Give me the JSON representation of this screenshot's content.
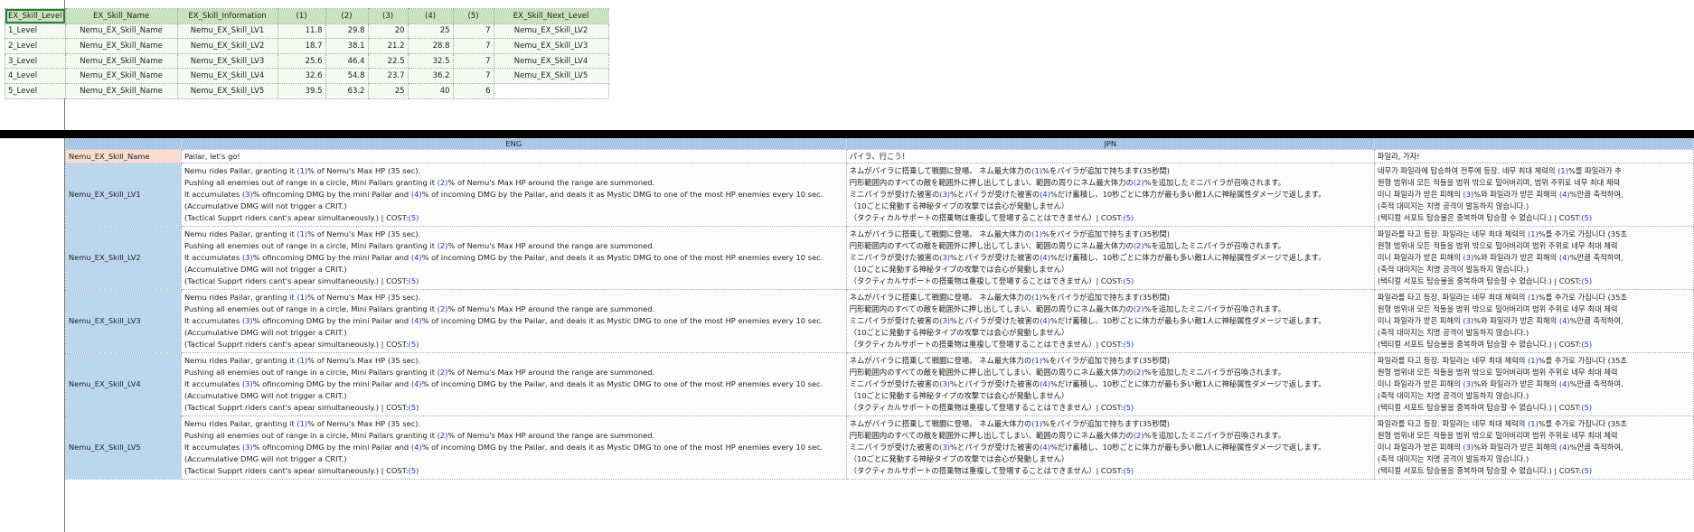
{
  "top_table": {
    "headers": [
      "EX_Skill_Level",
      "EX_Skill_Name",
      "EX_Skill_Information",
      "(1)",
      "(2)",
      "(3)",
      "(4)",
      "(5)",
      "EX_Skill_Next_Level"
    ],
    "rows": [
      [
        "1_Level",
        "Nemu_EX_Skill_Name",
        "Nemu_EX_Skill_LV1",
        "11.8",
        "29.8",
        "20",
        "25",
        "7",
        "Nemu_EX_Skill_LV2"
      ],
      [
        "2_Level",
        "Nemu_EX_Skill_Name",
        "Nemu_EX_Skill_LV2",
        "18.7",
        "38.1",
        "21.2",
        "28.8",
        "7",
        "Nemu_EX_Skill_LV3"
      ],
      [
        "3_Level",
        "Nemu_EX_Skill_Name",
        "Nemu_EX_Skill_LV3",
        "25.6",
        "46.4",
        "22.5",
        "32.5",
        "7",
        "Nemu_EX_Skill_LV4"
      ],
      [
        "4_Level",
        "Nemu_EX_Skill_Name",
        "Nemu_EX_Skill_LV4",
        "32.6",
        "54.8",
        "23.7",
        "36.2",
        "7",
        "Nemu_EX_Skill_LV5"
      ],
      [
        "5_Level",
        "Nemu_EX_Skill_Name",
        "Nemu_EX_Skill_LV5",
        "39.5",
        "63.2",
        "25",
        "40",
        "6",
        ""
      ]
    ]
  },
  "bottom_table": {
    "col_headers": [
      "",
      "ENG",
      "JPN",
      ""
    ],
    "name_row": {
      "key": "Nemu_EX_Skill_Name",
      "eng": "Pailar, let's go!",
      "jpn": "パイラ、行こう！",
      "kor": "파일라, 가자!"
    },
    "level_keys": [
      "Nemu_EX_Skill_LV1",
      "Nemu_EX_Skill_LV2",
      "Nemu_EX_Skill_LV3",
      "Nemu_EX_Skill_LV4",
      "Nemu_EX_Skill_LV5"
    ],
    "eng_lines": [
      [
        "Nemu rides Pailar, granting it ",
        "(1)",
        "% of Nemu's Max HP (35 sec)."
      ],
      [
        "Pushing all enemies out of range in a circle, Mini Pailars granting it ",
        "(2)",
        "% of Nemu's Max HP around the range are summoned."
      ],
      [
        "It accumulates ",
        "(3)",
        "% ofincoming DMG by the mini Pailar and ",
        "(4)",
        "% of incoming DMG by the Pailar, and deals it as Mystic DMG to one of the most HP enemies every 10 sec."
      ],
      [
        "(Accumulative DMG will not trigger a CRIT.)"
      ],
      [
        "(Tactical Supprt riders cant's apear simultaneously.) | COST:",
        "(5)"
      ]
    ],
    "jpn_lines": [
      [
        "ネムがパイラに搭乗して戦闘に登場。 ネム最大体力の",
        "(1)",
        "%をパイラが追加で持ちます(35秒間)"
      ],
      [
        "円形範囲内のすべての敵を範囲外に押し出してしまい、範囲の周りにネム最大体力の",
        "(2)",
        "%を追加したミニパイラが召喚されます。"
      ],
      [
        "ミニパイラが受けた被害の",
        "(3)",
        "%とパイラが受けた被害の",
        "(4)",
        "%だけ蓄積し、10秒ごとに体力が最も多い敵1人に神秘属性ダメージで返します。"
      ],
      [
        "（10ごとに発動する神秘タイプの攻撃では会心が発動しません）"
      ],
      [
        "（タクティカルサポートの搭乗物は重複して登場することはできません）| COST:",
        "(5)"
      ]
    ],
    "kor_lines_lv1": [
      [
        "네무가 파일라에 탑승하여 전투에 등장. 네무 최대 체력의 ",
        "(1)",
        "%를 파일라가 추"
      ],
      [
        "원형 범위내 모든 적들을 범위 밖으로 밀어버리며, 범위 주위로 네무 최대 체력"
      ],
      [
        "미니 파일라가 받은 피해의 ",
        "(3)",
        "%와 파일라가 받은 피해의 ",
        "(4)",
        "%만큼 축적하여,"
      ],
      [
        "(축적 대미지는 치명 공격이 발동하지 않습니다.)"
      ],
      [
        "(택티컬 서포트 탑승물은 중복하여 탑승할 수 없습니다.) | COST:",
        "(5)"
      ]
    ],
    "kor_lines": [
      [
        "파일라를 타고 등장. 파일라는 네무 최대 체력의 ",
        "(1)",
        "%를 추가로 가집니다 (35초"
      ],
      [
        "원형 범위내 모든 적들을 범위 밖으로 밀어버리며 범위 주위로 네무 최대 체력"
      ],
      [
        "미니 파일라가 받은 피해의 ",
        "(3)",
        "%와 파일라가 받은 피해의 ",
        "(4)",
        "%만큼 축적하여,"
      ],
      [
        "(축적 대미지는 치명 공격이 발동하지 않습니다.)"
      ],
      [
        "(택티컬 서포트 탑승물을 중복하여 탑승할 수 없습니다.) | COST:",
        "(5)"
      ]
    ]
  }
}
